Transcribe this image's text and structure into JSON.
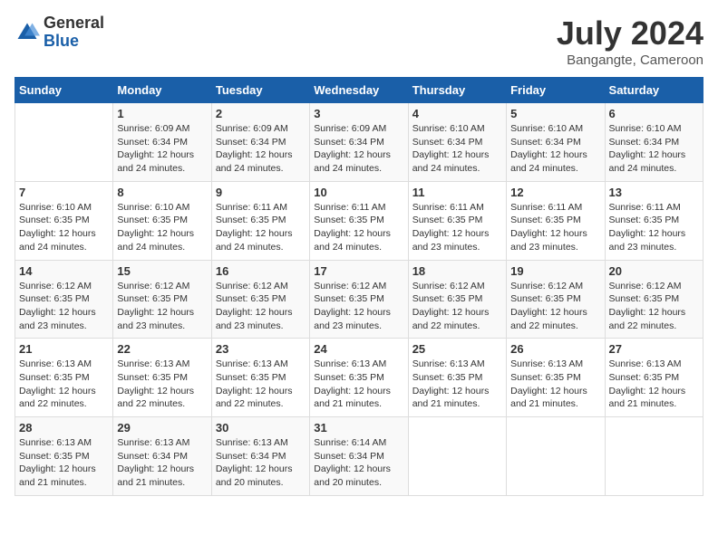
{
  "logo": {
    "general": "General",
    "blue": "Blue"
  },
  "title": "July 2024",
  "location": "Bangangte, Cameroon",
  "days_of_week": [
    "Sunday",
    "Monday",
    "Tuesday",
    "Wednesday",
    "Thursday",
    "Friday",
    "Saturday"
  ],
  "weeks": [
    [
      {
        "day": "",
        "sunrise": "",
        "sunset": "",
        "daylight": ""
      },
      {
        "day": "1",
        "sunrise": "6:09 AM",
        "sunset": "6:34 PM",
        "daylight": "12 hours and 24 minutes."
      },
      {
        "day": "2",
        "sunrise": "6:09 AM",
        "sunset": "6:34 PM",
        "daylight": "12 hours and 24 minutes."
      },
      {
        "day": "3",
        "sunrise": "6:09 AM",
        "sunset": "6:34 PM",
        "daylight": "12 hours and 24 minutes."
      },
      {
        "day": "4",
        "sunrise": "6:10 AM",
        "sunset": "6:34 PM",
        "daylight": "12 hours and 24 minutes."
      },
      {
        "day": "5",
        "sunrise": "6:10 AM",
        "sunset": "6:34 PM",
        "daylight": "12 hours and 24 minutes."
      },
      {
        "day": "6",
        "sunrise": "6:10 AM",
        "sunset": "6:34 PM",
        "daylight": "12 hours and 24 minutes."
      }
    ],
    [
      {
        "day": "7",
        "sunrise": "6:10 AM",
        "sunset": "6:35 PM",
        "daylight": "12 hours and 24 minutes."
      },
      {
        "day": "8",
        "sunrise": "6:10 AM",
        "sunset": "6:35 PM",
        "daylight": "12 hours and 24 minutes."
      },
      {
        "day": "9",
        "sunrise": "6:11 AM",
        "sunset": "6:35 PM",
        "daylight": "12 hours and 24 minutes."
      },
      {
        "day": "10",
        "sunrise": "6:11 AM",
        "sunset": "6:35 PM",
        "daylight": "12 hours and 24 minutes."
      },
      {
        "day": "11",
        "sunrise": "6:11 AM",
        "sunset": "6:35 PM",
        "daylight": "12 hours and 23 minutes."
      },
      {
        "day": "12",
        "sunrise": "6:11 AM",
        "sunset": "6:35 PM",
        "daylight": "12 hours and 23 minutes."
      },
      {
        "day": "13",
        "sunrise": "6:11 AM",
        "sunset": "6:35 PM",
        "daylight": "12 hours and 23 minutes."
      }
    ],
    [
      {
        "day": "14",
        "sunrise": "6:12 AM",
        "sunset": "6:35 PM",
        "daylight": "12 hours and 23 minutes."
      },
      {
        "day": "15",
        "sunrise": "6:12 AM",
        "sunset": "6:35 PM",
        "daylight": "12 hours and 23 minutes."
      },
      {
        "day": "16",
        "sunrise": "6:12 AM",
        "sunset": "6:35 PM",
        "daylight": "12 hours and 23 minutes."
      },
      {
        "day": "17",
        "sunrise": "6:12 AM",
        "sunset": "6:35 PM",
        "daylight": "12 hours and 23 minutes."
      },
      {
        "day": "18",
        "sunrise": "6:12 AM",
        "sunset": "6:35 PM",
        "daylight": "12 hours and 22 minutes."
      },
      {
        "day": "19",
        "sunrise": "6:12 AM",
        "sunset": "6:35 PM",
        "daylight": "12 hours and 22 minutes."
      },
      {
        "day": "20",
        "sunrise": "6:12 AM",
        "sunset": "6:35 PM",
        "daylight": "12 hours and 22 minutes."
      }
    ],
    [
      {
        "day": "21",
        "sunrise": "6:13 AM",
        "sunset": "6:35 PM",
        "daylight": "12 hours and 22 minutes."
      },
      {
        "day": "22",
        "sunrise": "6:13 AM",
        "sunset": "6:35 PM",
        "daylight": "12 hours and 22 minutes."
      },
      {
        "day": "23",
        "sunrise": "6:13 AM",
        "sunset": "6:35 PM",
        "daylight": "12 hours and 22 minutes."
      },
      {
        "day": "24",
        "sunrise": "6:13 AM",
        "sunset": "6:35 PM",
        "daylight": "12 hours and 21 minutes."
      },
      {
        "day": "25",
        "sunrise": "6:13 AM",
        "sunset": "6:35 PM",
        "daylight": "12 hours and 21 minutes."
      },
      {
        "day": "26",
        "sunrise": "6:13 AM",
        "sunset": "6:35 PM",
        "daylight": "12 hours and 21 minutes."
      },
      {
        "day": "27",
        "sunrise": "6:13 AM",
        "sunset": "6:35 PM",
        "daylight": "12 hours and 21 minutes."
      }
    ],
    [
      {
        "day": "28",
        "sunrise": "6:13 AM",
        "sunset": "6:35 PM",
        "daylight": "12 hours and 21 minutes."
      },
      {
        "day": "29",
        "sunrise": "6:13 AM",
        "sunset": "6:34 PM",
        "daylight": "12 hours and 21 minutes."
      },
      {
        "day": "30",
        "sunrise": "6:13 AM",
        "sunset": "6:34 PM",
        "daylight": "12 hours and 20 minutes."
      },
      {
        "day": "31",
        "sunrise": "6:14 AM",
        "sunset": "6:34 PM",
        "daylight": "12 hours and 20 minutes."
      },
      {
        "day": "",
        "sunrise": "",
        "sunset": "",
        "daylight": ""
      },
      {
        "day": "",
        "sunrise": "",
        "sunset": "",
        "daylight": ""
      },
      {
        "day": "",
        "sunrise": "",
        "sunset": "",
        "daylight": ""
      }
    ]
  ]
}
